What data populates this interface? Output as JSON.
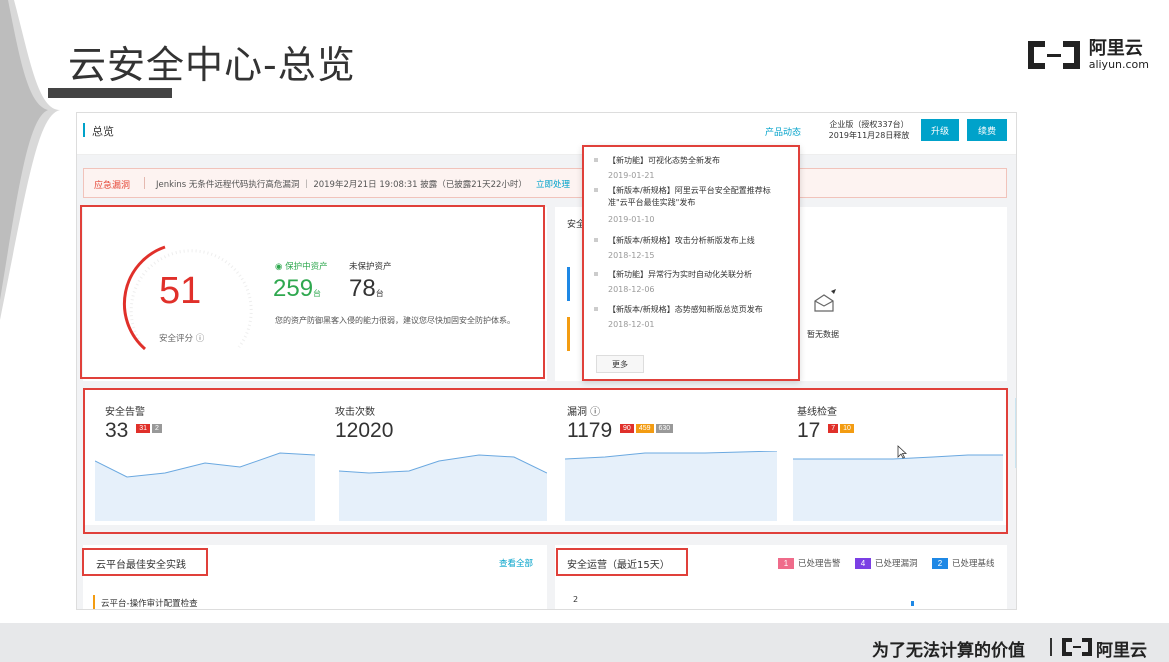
{
  "slide": {
    "title": "云安全中心-总览",
    "brand_cn": "阿里云",
    "brand_en": "aliyun.com",
    "footer_slogan": "为了无法计算的价值",
    "footer_brand": "阿里云"
  },
  "topbar": {
    "page_title": "总览",
    "news_link": "产品动态",
    "edition_line1": "企业版（授权337台）",
    "edition_line2": "2019年11月28日释放",
    "upgrade_label": "升级",
    "renew_label": "续费"
  },
  "alert": {
    "tag": "应急漏洞",
    "message": "Jenkins 无条件远程代码执行高危漏洞 ｜ 2019年2月21日 19:08:31 披露（已披露21天22小时）",
    "action": "立即处理"
  },
  "score": {
    "value": "51",
    "label": "安全评分 ⓘ",
    "protected_label": "保护中资产",
    "protected_value": "259",
    "unprotected_label": "未保护资产",
    "unprotected_value": "78",
    "unit": "台",
    "hint": "您的资产防御黑客入侵的能力很弱，建议您尽快加固安全防护体系。"
  },
  "news": {
    "items": [
      {
        "title": "【新功能】可视化态势全新发布",
        "date": "2019-01-21"
      },
      {
        "title": "【新版本/新规格】阿里云平台安全配置推荐标准\"云平台最佳实践\"发布",
        "date": "2019-01-10"
      },
      {
        "title": "【新版本/新规格】攻击分析新版发布上线",
        "date": "2018-12-15"
      },
      {
        "title": "【新功能】异常行为实时自动化关联分析",
        "date": "2018-12-06"
      },
      {
        "title": "【新版本/新规格】态势感知新版总览页发布",
        "date": "2018-12-01"
      }
    ],
    "more_label": "更多"
  },
  "right_panel": {
    "header": "安全",
    "empty_label": "暂无数据"
  },
  "stats": [
    {
      "label": "安全告警",
      "value": "33",
      "badges": [
        {
          "text": "31",
          "color": "#e0302a"
        },
        {
          "text": "2",
          "color": "#999999"
        }
      ]
    },
    {
      "label": "攻击次数",
      "value": "12020",
      "badges": []
    },
    {
      "label": "漏洞 ⓘ",
      "value": "1179",
      "badges": [
        {
          "text": "90",
          "color": "#e0302a"
        },
        {
          "text": "459",
          "color": "#f39c12"
        },
        {
          "text": "630",
          "color": "#999999"
        }
      ]
    },
    {
      "label": "基线检查",
      "value": "17",
      "badges": [
        {
          "text": "7",
          "color": "#e0302a"
        },
        {
          "text": "10",
          "color": "#f39c12"
        }
      ]
    }
  ],
  "bottom": {
    "best_practice_title": "云平台最佳安全实践",
    "view_all": "查看全部",
    "best_practice_item": "云平台-操作审计配置检查",
    "ops_title": "安全运营（最近15天）",
    "legend": [
      {
        "num": "1",
        "label": "已处理告警",
        "color": "#ef6b8a"
      },
      {
        "num": "4",
        "label": "已处理漏洞",
        "color": "#7b3fe4"
      },
      {
        "num": "2",
        "label": "已处理基线",
        "color": "#1e88e5"
      }
    ],
    "axis_tick": "2"
  },
  "colors": {
    "accent": "#00a2ca",
    "danger": "#e0302a",
    "success": "#2fa84f",
    "highlight_box": "#e0403a"
  }
}
